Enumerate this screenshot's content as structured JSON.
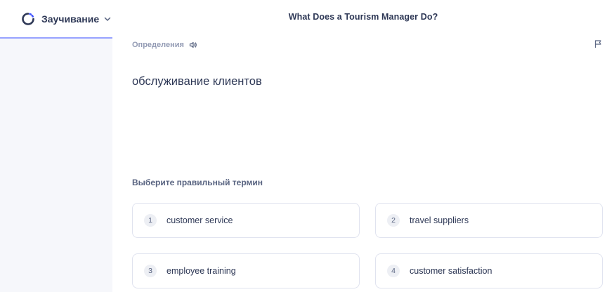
{
  "header": {
    "mode_label": "Заучивание",
    "set_title": "What Does a Tourism Manager Do?",
    "icons": {
      "mode": "learn-loop-icon",
      "dropdown": "chevron-down-icon"
    }
  },
  "question": {
    "type_label": "Определения",
    "prompt": "обслуживание клиентов",
    "icons": {
      "audio": "speaker-icon",
      "report": "flag-icon"
    }
  },
  "answers": {
    "instruction": "Выберите правильный термин",
    "options": [
      {
        "number": "1",
        "text": "customer service"
      },
      {
        "number": "2",
        "text": "travel suppliers"
      },
      {
        "number": "3",
        "text": "employee training"
      },
      {
        "number": "4",
        "text": "customer satisfaction"
      }
    ]
  },
  "colors": {
    "accent": "#4255ff",
    "text": "#2e3856",
    "muted": "#939bb4",
    "sidebar_bg": "#f6f7fb",
    "option_border": "#e0e3ef"
  }
}
